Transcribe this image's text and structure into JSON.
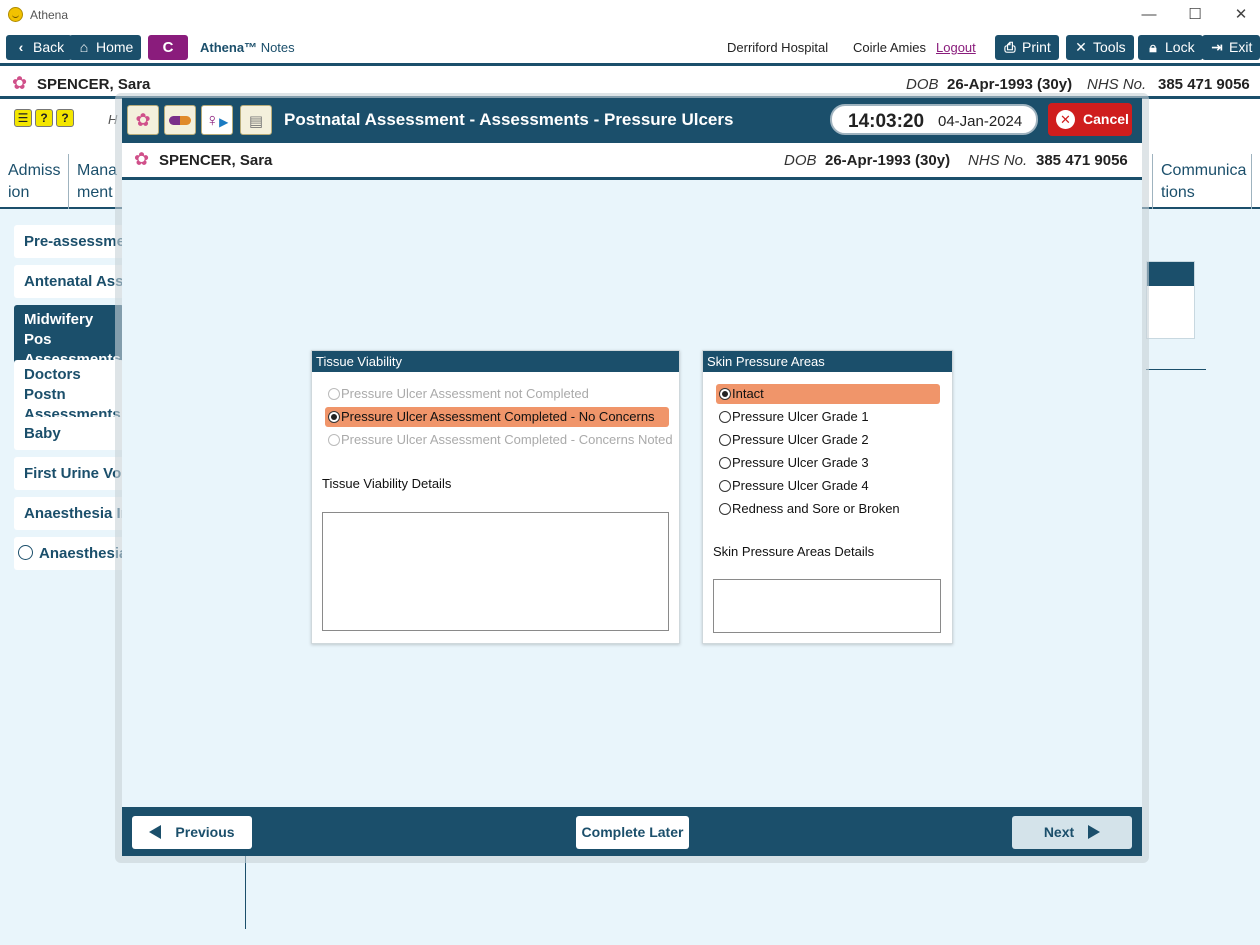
{
  "window": {
    "title": "Athena"
  },
  "toolbar": {
    "back": "Back",
    "home": "Home",
    "c_label": "C",
    "app_name": "Athena™",
    "app_sub": "Notes",
    "hospital": "Derriford Hospital",
    "user": "Coirle Amies",
    "logout": "Logout",
    "print": "Print",
    "tools": "Tools",
    "lock": "Lock",
    "exit": "Exit"
  },
  "patient": {
    "name": "SPENCER, Sara",
    "dob_label": "DOB",
    "dob": "26-Apr-1993 (30y)",
    "nhs_label": "NHS No.",
    "nhs": "385 471 9056"
  },
  "background": {
    "h_label": "H",
    "tabs": [
      {
        "label": "Admiss ion"
      },
      {
        "label": "Mana ment"
      },
      {
        "label": "Communica tions"
      }
    ],
    "nav": [
      {
        "label": "Pre-assessmer"
      },
      {
        "label": "Antenatal Ass"
      },
      {
        "label": "Midwifery Pos Assessments"
      },
      {
        "label": "Doctors Postn Assessments"
      },
      {
        "label": "Baby"
      },
      {
        "label": "First Urine Voi"
      },
      {
        "label": "Anaesthesia Ir"
      },
      {
        "label": "Anaesthesia"
      }
    ]
  },
  "modal": {
    "title": "Postnatal Assessment - Assessments - Pressure Ulcers",
    "time": "14:03:20",
    "date": "04-Jan-2024",
    "cancel": "Cancel",
    "tissue": {
      "header": "Tissue Viability",
      "options": [
        {
          "label": "Pressure Ulcer Assessment not Completed"
        },
        {
          "label": "Pressure Ulcer Assessment Completed - No Concerns"
        },
        {
          "label": "Pressure Ulcer Assessment Completed - Concerns Noted"
        }
      ],
      "details_label": "Tissue Viability Details",
      "details_value": ""
    },
    "skin": {
      "header": "Skin Pressure Areas",
      "options": [
        {
          "label": "Intact"
        },
        {
          "label": "Pressure Ulcer Grade 1"
        },
        {
          "label": "Pressure Ulcer Grade 2"
        },
        {
          "label": "Pressure Ulcer Grade 3"
        },
        {
          "label": "Pressure Ulcer Grade 4"
        },
        {
          "label": "Redness and Sore or Broken"
        }
      ],
      "details_label": "Skin Pressure Areas Details",
      "details_value": ""
    },
    "footer": {
      "previous": "Previous",
      "complete_later": "Complete Later",
      "next": "Next"
    }
  },
  "colors": {
    "primary": "#1b4f6b",
    "selected": "#f0956a",
    "cancel": "#cf1d1d",
    "c_button": "#8a1c7c",
    "background": "#e9f5fb"
  }
}
